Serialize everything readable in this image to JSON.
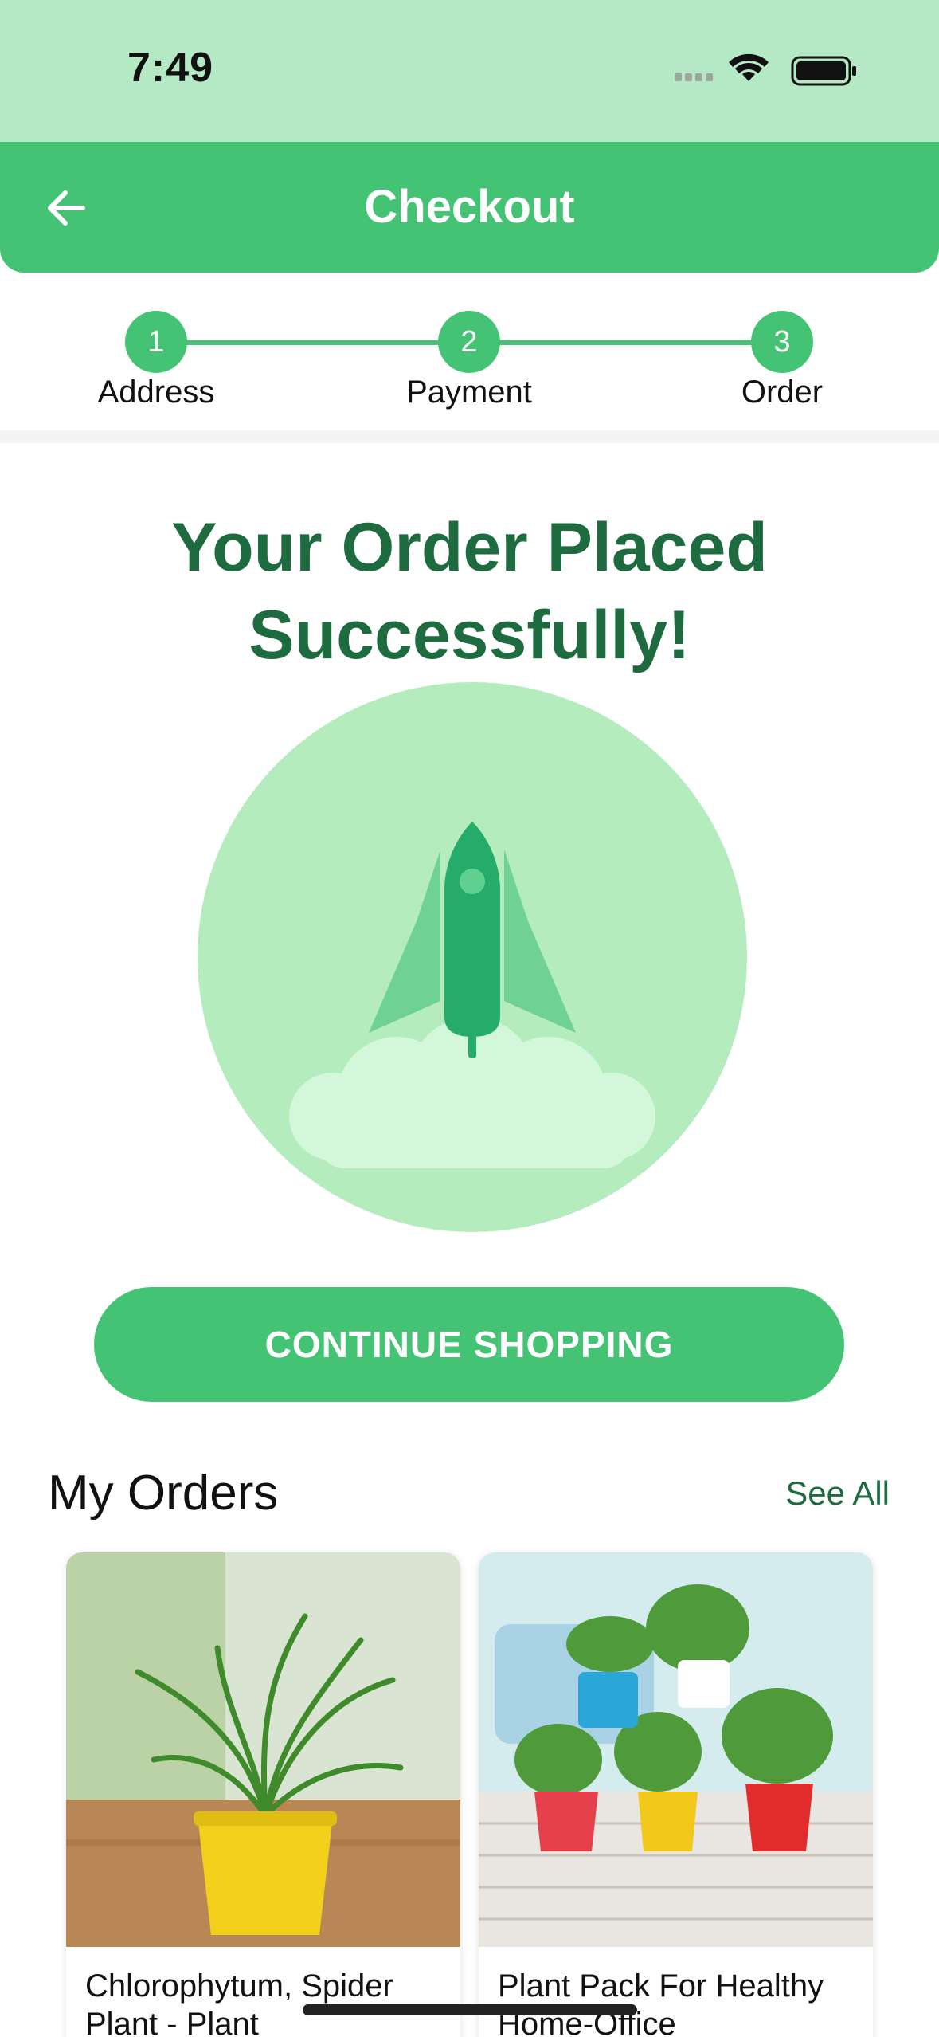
{
  "status_bar": {
    "time": "7:49"
  },
  "header": {
    "title": "Checkout",
    "back_icon": "arrow-left-icon"
  },
  "stepper": {
    "steps": [
      {
        "number": "1",
        "label": "Address"
      },
      {
        "number": "2",
        "label": "Payment"
      },
      {
        "number": "3",
        "label": "Order"
      }
    ]
  },
  "success": {
    "title_line1": "Your Order Placed",
    "title_line2": "Successfully!",
    "illustration_icon": "rocket-launch-icon"
  },
  "actions": {
    "continue_label": "CONTINUE SHOPPING"
  },
  "orders": {
    "title": "My Orders",
    "see_all_label": "See All",
    "items": [
      {
        "name": "Chlorophytum, Spider Plant - Plant"
      },
      {
        "name": "Plant Pack For Healthy Home-Office"
      }
    ]
  },
  "colors": {
    "accent": "#45c374",
    "status_bar": "#b5e8c4",
    "title_green": "#1f6b40"
  }
}
